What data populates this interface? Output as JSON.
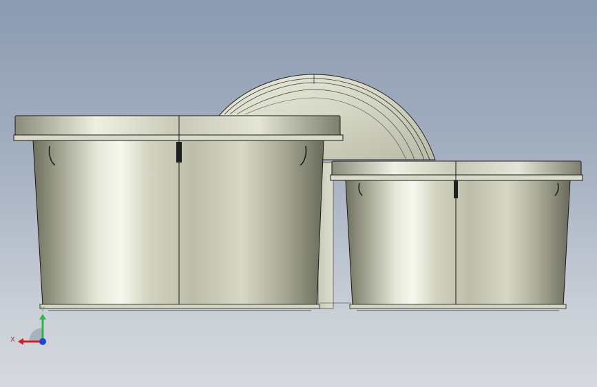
{
  "viewport": {
    "background_top": "#8c9bb1",
    "background_bottom": "#d6dadf",
    "model_color": "#c8c9b4",
    "edge_color": "#1a1a1a",
    "objects": [
      "large-pot",
      "small-pot",
      "round-lid"
    ]
  },
  "triad": {
    "x_label": "X",
    "y_label": "Y",
    "x_color": "#d01f2a",
    "y_color": "#2db84b",
    "z_color": "#1d47d6"
  }
}
